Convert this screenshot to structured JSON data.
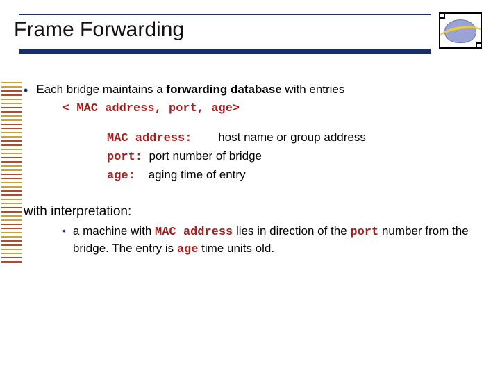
{
  "title": "Frame Forwarding",
  "bullet_intro_pre": "Each bridge maintains a ",
  "bullet_intro_bold": "forwarding database",
  "bullet_intro_post": " with entries",
  "entry_tuple": "< MAC address, port, age>",
  "defs": {
    "mac_label": "MAC address:",
    "mac_text": "host name or group address",
    "port_label": "port:",
    "port_text": "port number of bridge",
    "age_label": "age:",
    "age_text": "aging time of entry"
  },
  "interp_head": "with interpretation:",
  "interp_parts": {
    "p1": "a machine with ",
    "mac": "MAC address",
    "p2": " lies in direction of the ",
    "port": "port",
    "p3": " number from the bridge. The entry is ",
    "age": "age",
    "p4": " time units old."
  },
  "stripe_colors": [
    "#caa338",
    "#caa338",
    "#b34a2f",
    "#b34a2f",
    "#caa338",
    "#caa338",
    "#b34a2f",
    "#b34a2f",
    "#caa338",
    "#caa338",
    "#b34a2f",
    "#b34a2f",
    "#caa338",
    "#caa338",
    "#b34a2f",
    "#b34a2f",
    "#caa338",
    "#caa338",
    "#b34a2f",
    "#b34a2f",
    "#caa338",
    "#caa338",
    "#b34a2f",
    "#b34a2f",
    "#caa338",
    "#caa338",
    "#b34a2f",
    "#b34a2f",
    "#caa338",
    "#caa338",
    "#b34a2f",
    "#b34a2f",
    "#caa338",
    "#caa338",
    "#b34a2f",
    "#b34a2f",
    "#caa338",
    "#caa338",
    "#b34a2f",
    "#b34a2f",
    "#caa338",
    "#caa338",
    "#b34a2f",
    "#b34a2f"
  ]
}
